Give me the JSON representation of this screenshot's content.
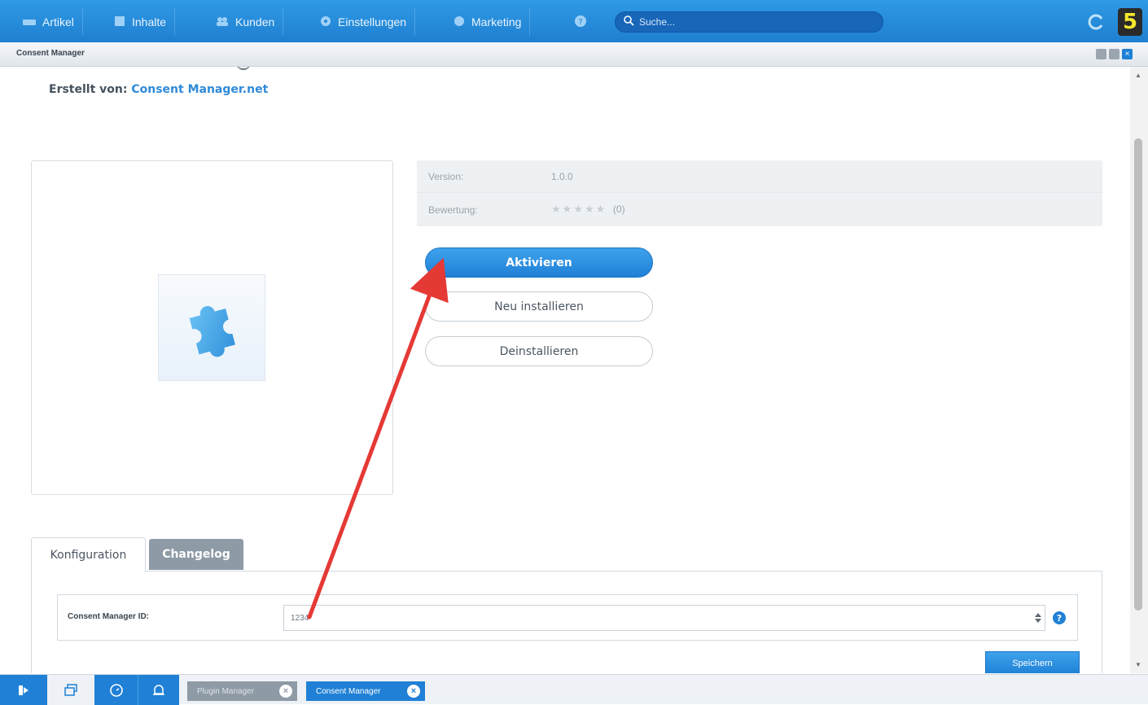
{
  "nav": {
    "items": [
      {
        "label": "Artikel",
        "icon": "articles-icon"
      },
      {
        "label": "Inhalte",
        "icon": "content-icon"
      },
      {
        "label": "Kunden",
        "icon": "customers-icon"
      },
      {
        "label": "Einstellungen",
        "icon": "settings-icon"
      },
      {
        "label": "Marketing",
        "icon": "marketing-icon"
      }
    ],
    "search_placeholder": "Suche..."
  },
  "window": {
    "title": "Consent Manager"
  },
  "plugin": {
    "created_by_label": "Erstellt von:",
    "created_by_value": "Consent Manager.net",
    "info": {
      "version_label": "Version:",
      "version_value": "1.0.0",
      "rating_label": "Bewertung:",
      "rating_stars": 0,
      "rating_count": "(0)"
    },
    "buttons": {
      "activate": "Aktivieren",
      "reinstall": "Neu installieren",
      "uninstall": "Deinstallieren"
    }
  },
  "tabs": {
    "config": "Konfiguration",
    "changelog": "Changelog"
  },
  "config": {
    "field_label": "Consent Manager ID:",
    "field_value": "1234",
    "save_label": "Speichern"
  },
  "taskbar": {
    "tabs": [
      {
        "label": "Plugin Manager"
      },
      {
        "label": "Consent Manager"
      }
    ]
  },
  "colors": {
    "accent": "#1f80d6",
    "annotation_arrow": "#e53935"
  }
}
